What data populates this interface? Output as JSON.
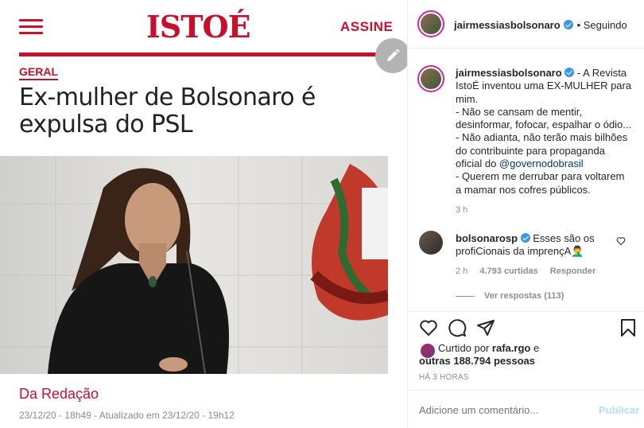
{
  "article": {
    "brand": "ISTOÉ",
    "subscribe_label": "ASSINE",
    "section": "GERAL",
    "headline": "Ex-mulher de Bolsonaro é expulsa do PSL",
    "byline": "Da Redação",
    "dateline": "23/12/20 - 18h49 - Atualizado em 23/12/20 - 19h12"
  },
  "post": {
    "username": "jairmessiasbolsonaro",
    "follow_status": "• Seguindo",
    "caption_intro": "- A Revista IstoÉ inventou uma EX-MULHER para mim.",
    "caption_line1": "- Não se cansam de mentir, desinformar, fofocar, espalhar o ódio...",
    "caption_line2_pre": "- Não adianta, não terão mais bilhões do contribuinte para propaganda oficial do ",
    "caption_mention": "@governodobrasil",
    "caption_line3": "- Querem me derrubar para voltarem a mamar nos cofres públicos.",
    "caption_time": "3 h"
  },
  "comment": {
    "username": "bolsonarosp",
    "text": "Esses são os profiCionais da imprençA",
    "emoji": "🤦‍♂️",
    "time": "2 h",
    "likes": "4.793 curtidas",
    "reply_label": "Responder",
    "view_replies": "Ver respostas (113)"
  },
  "likes": {
    "prefix": "Curtido por ",
    "user": "rafa.rgo",
    "middle": " e ",
    "others": "outras 188.794 pessoas",
    "time_ago": "HÁ 3 HORAS"
  },
  "comment_box": {
    "placeholder": "Adicione um comentário...",
    "post_label": "Publicar"
  },
  "icons": {
    "menu": "hamburger-icon",
    "edit": "pencil-icon",
    "like": "heart-icon",
    "comment": "speech-bubble-icon",
    "share": "paper-plane-icon",
    "save": "bookmark-icon"
  },
  "colors": {
    "brand_red": "#c8102e",
    "verified_blue": "#3897f0",
    "link": "#00376b",
    "muted": "#8e8e8e"
  }
}
